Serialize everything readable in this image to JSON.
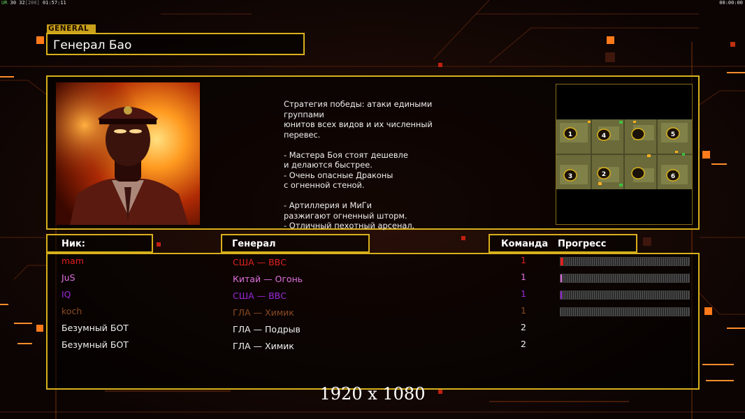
{
  "hud": {
    "left_prefix": "UR",
    "left_fps": "30 32",
    "left_bracket": "[200]",
    "left_time": "01:57:11",
    "right_time": "00:00:00"
  },
  "general": {
    "tag": "GENERAL",
    "name": "Генерал Бао",
    "strategy_text": "Стратегия победы: атаки едиными группами\nюнитов всех видов и их численный перевес.\n\n- Мастера Боя стоят дешевле\nи делаются быстрее.\n- Очень опасные Драконы\nс огненной стеной.\n\n- Артиллерия и МиГи\nразжигают огненный шторм.\n- Отличный пехотный арсенал."
  },
  "minimap": {
    "slots": [
      "1",
      "4",
      "5",
      "3",
      "2",
      "6"
    ]
  },
  "table": {
    "col_nick": "Ник:",
    "col_general": "Генерал",
    "col_team": "Команда",
    "col_progress": "Прогресс",
    "rows": [
      {
        "nick": "mam",
        "general": "США — ВВС",
        "team": "1",
        "color": "#e02020",
        "progress": 0.02
      },
      {
        "nick": "JuS",
        "general": "Китай — Огонь",
        "team": "1",
        "color": "#e070e0",
        "progress": 0.01
      },
      {
        "nick": "IQ",
        "general": "США — ВВС",
        "team": "1",
        "color": "#9a28d8",
        "progress": 0.01
      },
      {
        "nick": "koch",
        "general": "ГЛА — Химик",
        "team": "1",
        "color": "#8b4a22",
        "progress": 0
      },
      {
        "nick": "Безумный БОТ",
        "general": "ГЛА — Подрыв",
        "team": "2",
        "color": "#f2f2f2",
        "progress": null
      },
      {
        "nick": "Безумный БОТ",
        "general": "ГЛА — Химик",
        "team": "2",
        "color": "#f2f2f2",
        "progress": null
      }
    ]
  },
  "resolution": "1920 x 1080"
}
